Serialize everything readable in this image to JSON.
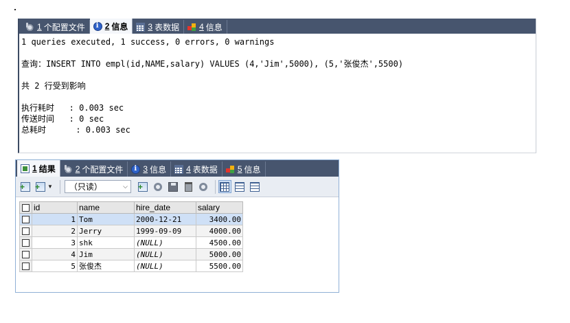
{
  "panel1": {
    "tabs": [
      {
        "num": "1",
        "label": "个配置文件",
        "icon": "gear-icon",
        "active": false
      },
      {
        "num": "2",
        "label": "信息",
        "icon": "info-icon",
        "active": true
      },
      {
        "num": "3",
        "label": "表数据",
        "icon": "table-icon",
        "active": false
      },
      {
        "num": "4",
        "label": "信息",
        "icon": "blocks-icon",
        "active": false
      }
    ],
    "lines": [
      "1 queries executed, 1 success, 0 errors, 0 warnings",
      "",
      "查询：INSERT INTO empl(id,NAME,salary) VALUES (4,'Jim',5000), (5,'张俊杰',5500)",
      "",
      "共 2 行受到影响",
      "",
      "执行耗时   : 0.003 sec",
      "传送时间   : 0 sec",
      "总耗时      : 0.003 sec"
    ]
  },
  "panel2": {
    "tabs": [
      {
        "num": "1",
        "label": "结果",
        "icon": "result-icon",
        "active": true
      },
      {
        "num": "2",
        "label": "个配置文件",
        "icon": "gear-icon",
        "active": false
      },
      {
        "num": "3",
        "label": "信息",
        "icon": "info-icon",
        "active": false
      },
      {
        "num": "4",
        "label": "表数据",
        "icon": "table-icon",
        "active": false
      },
      {
        "num": "5",
        "label": "信息",
        "icon": "blocks-icon",
        "active": false
      }
    ],
    "mode_select": "（只读）",
    "columns": [
      "id",
      "name",
      "hire_date",
      "salary"
    ],
    "rows": [
      {
        "id": "1",
        "name": "Tom",
        "hire_date": "2000-12-21",
        "salary": "3400.00",
        "selected": true
      },
      {
        "id": "2",
        "name": "Jerry",
        "hire_date": "1999-09-09",
        "salary": "4000.00"
      },
      {
        "id": "3",
        "name": "shk",
        "hire_date": "(NULL)",
        "salary": "4500.00"
      },
      {
        "id": "4",
        "name": "Jim",
        "hire_date": "(NULL)",
        "salary": "5000.00"
      },
      {
        "id": "5",
        "name": "张俊杰",
        "hire_date": "(NULL)",
        "salary": "5500.00"
      }
    ]
  }
}
